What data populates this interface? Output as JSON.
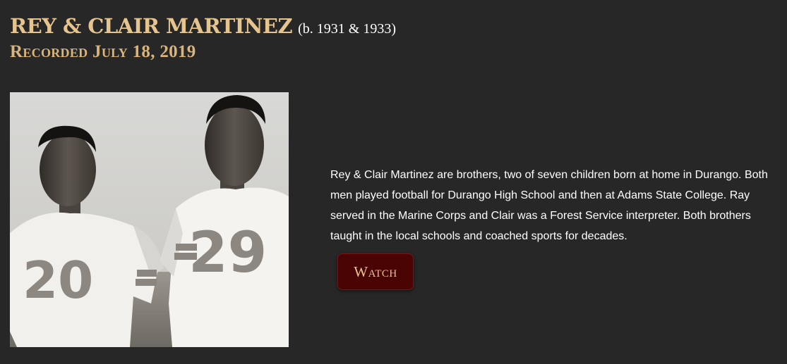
{
  "header": {
    "name": "REY & CLAIR MARTINEZ",
    "dates": "(b. 1931 & 1933)",
    "recorded": "Recorded July 18, 2019"
  },
  "photo": {
    "jersey_left": "20",
    "jersey_right": "29"
  },
  "bio": {
    "text": "Rey & Clair Martinez are brothers, two of seven children born at home in Durango. Both men played football for Durango High School and then at Adams State College. Ray served in the Marine Corps and Clair was a Forest Service interpreter.  Both brothers taught in the local schools and coached sports for decades."
  },
  "actions": {
    "watch_label": "Watch"
  },
  "colors": {
    "background": "#272727",
    "title_gold": "#e5c48e",
    "button_maroon": "#4a0303"
  }
}
